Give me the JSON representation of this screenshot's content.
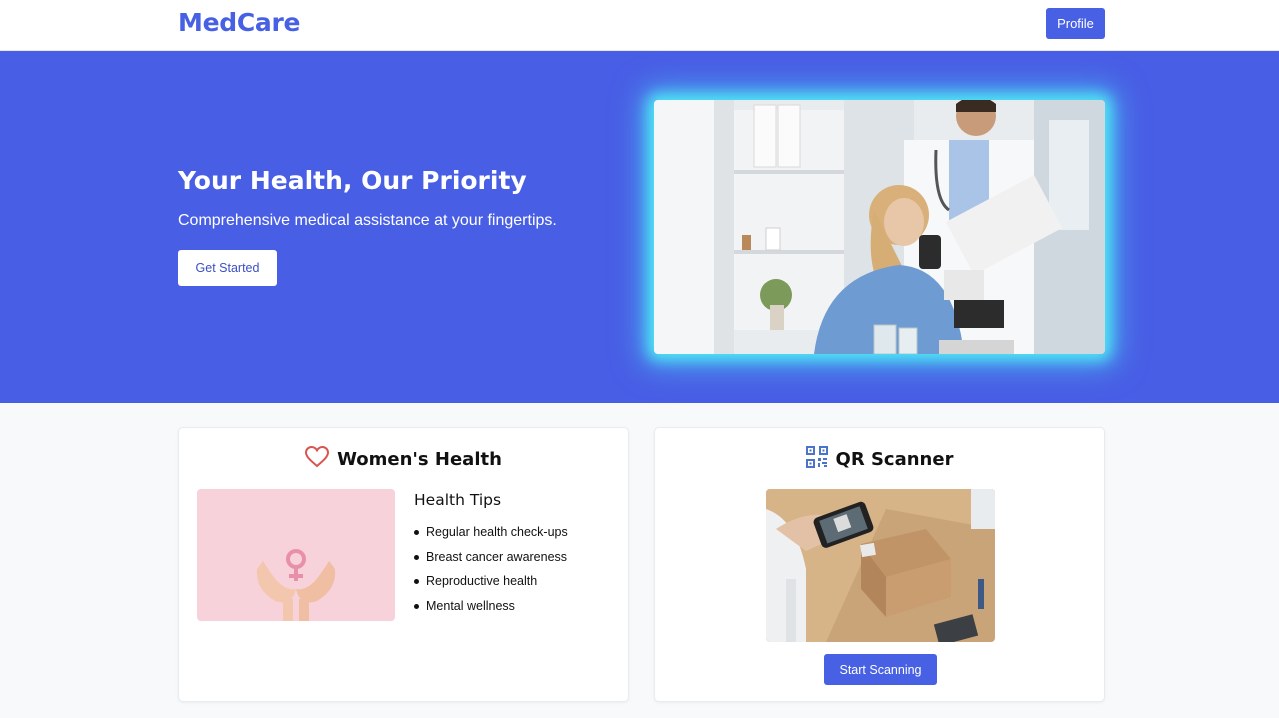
{
  "header": {
    "brand": "MedCare",
    "profile_label": "Profile"
  },
  "hero": {
    "title": "Your Health, Our Priority",
    "subtitle": "Comprehensive medical assistance at your fingertips.",
    "cta_label": "Get Started",
    "image_alt": "doctor-and-lab-technician-photo"
  },
  "womens_health": {
    "icon": "heart-icon",
    "title": "Women's Health",
    "image": "hands-holding-female-symbol-photo",
    "tips_title": "Health Tips",
    "tips": [
      "Regular health check-ups",
      "Breast cancer awareness",
      "Reproductive health",
      "Mental wellness"
    ]
  },
  "qr_scanner": {
    "icon": "qr-code-icon",
    "title": "QR Scanner",
    "image": "phone-scanning-package-photo",
    "button_label": "Start Scanning"
  },
  "colors": {
    "primary": "#4760e4",
    "hero_bg": "#485ee5",
    "glow": "#4fe6f5",
    "heart": "#d9534f",
    "page_bg": "#f7f9fb"
  }
}
